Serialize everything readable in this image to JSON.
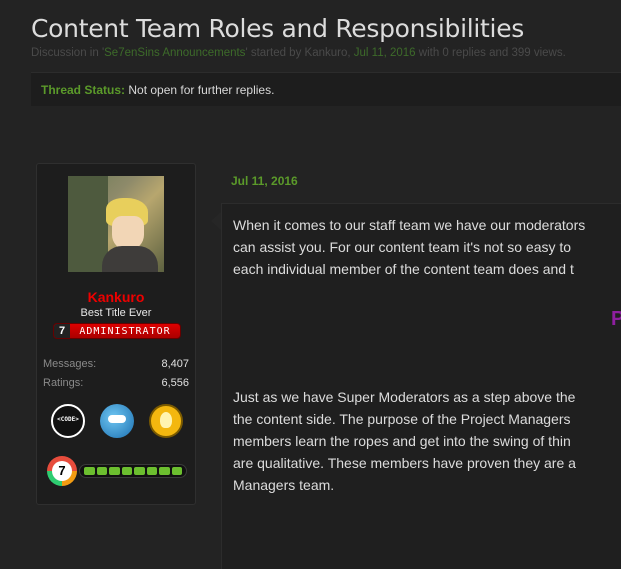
{
  "thread": {
    "title": "Content Team Roles and Responsibilities",
    "meta_prefix": "Discussion in '",
    "forum": "Se7enSins Announcements",
    "meta_started": "' started by ",
    "author": "Kankuro",
    "meta_sep": ", ",
    "date": "Jul 11, 2016",
    "meta_suffix": " with 0 replies and 399 views.",
    "status_label": "Thread Status:",
    "status_value": "Not open for further replies."
  },
  "user": {
    "name": "Kankuro",
    "title": "Best Title Ever",
    "banner_number": "7",
    "banner_text": "ADMINISTRATOR",
    "stats": [
      {
        "label": "Messages:",
        "value": "8,407"
      },
      {
        "label": "Ratings:",
        "value": "6,556"
      }
    ],
    "badges": [
      {
        "icon": "code-badge-icon",
        "text": "<CODE>"
      },
      {
        "icon": "mascot-badge-icon"
      },
      {
        "icon": "lightbulb-badge-icon"
      }
    ],
    "level": "7",
    "level_progress": 1.0
  },
  "post": {
    "date": "Jul 11, 2016",
    "lines1": [
      "When it comes to our staff team we have our moderators",
      "can assist you. For our content team it's not so easy to",
      "each individual member of the content team does and t"
    ],
    "heading_fragment": "P",
    "lines2": [
      "Just as we have Super Moderators as a step above the",
      "the content side. The purpose of the Project Managers",
      "members learn the ropes and get into the swing of thin",
      "are qualitative. These members have proven they are a",
      "Managers team."
    ]
  },
  "colors": {
    "accent_green": "#5b9a2a",
    "username_red": "#ee0000",
    "heading_purple": "#8e1fa0",
    "background": "#232323"
  }
}
